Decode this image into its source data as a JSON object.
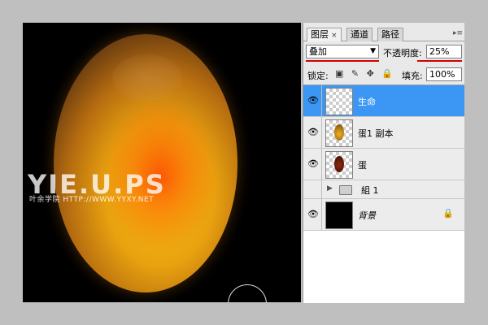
{
  "watermark": {
    "big": "YIE.U.PS",
    "small": "叶余学院 HTTP://WWW.YYXY.NET"
  },
  "panel": {
    "tabs": [
      {
        "label": "图层",
        "close": "×"
      },
      {
        "label": "通道"
      },
      {
        "label": "路径"
      }
    ],
    "menu_glyph": "▸≡",
    "blend_mode": "叠加",
    "blend_arrow": "▼",
    "opacity_label": "不透明度:",
    "opacity_value": "25%",
    "lock_label": "锁定:",
    "lock_icons": "▣ ✎ ✥ 🔒",
    "fill_label": "填充:",
    "fill_value": "100%"
  },
  "layers": [
    {
      "name": "生命",
      "visible": true,
      "selected": true,
      "thumb": "transparent"
    },
    {
      "name": "蛋1 副本",
      "visible": true,
      "selected": false,
      "thumb": "egg-gold"
    },
    {
      "name": "蛋",
      "visible": true,
      "selected": false,
      "thumb": "egg-brown"
    },
    {
      "name": "組 1",
      "visible": false,
      "type": "group"
    },
    {
      "name": "背景",
      "visible": true,
      "selected": false,
      "thumb": "black",
      "locked": true
    }
  ],
  "icons": {
    "eye": "👁",
    "group_arrow": "▶",
    "lock": "🔒"
  },
  "colors": {
    "selection": "#3b96f4",
    "underline": "#d40000",
    "canvas": "#000000"
  }
}
